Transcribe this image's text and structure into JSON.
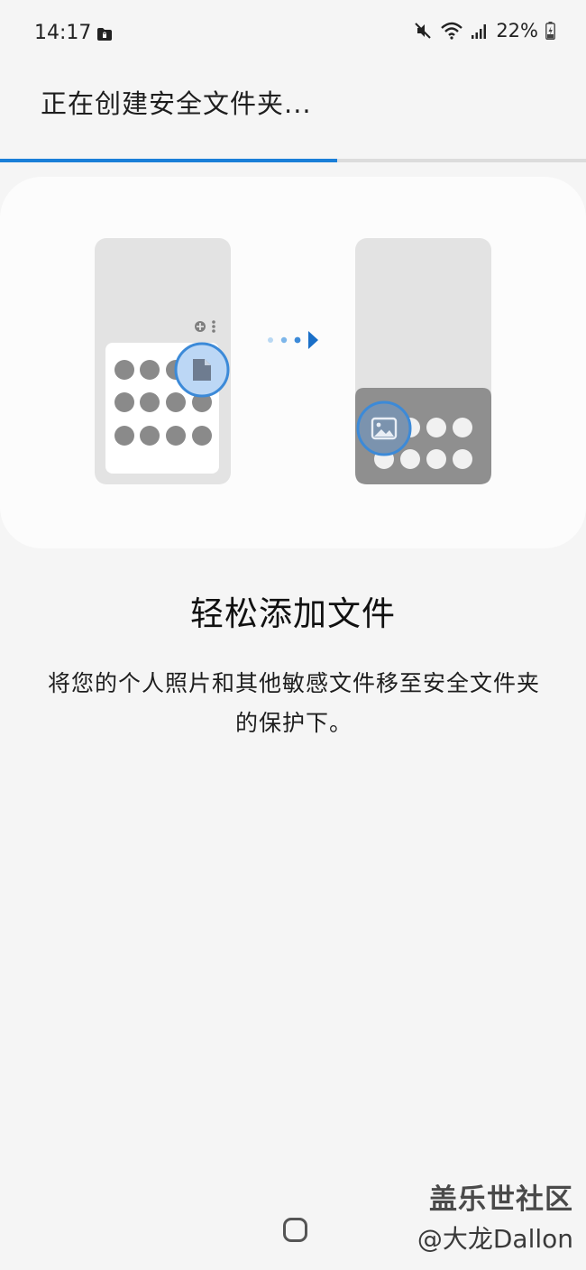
{
  "status_bar": {
    "time": "14:17",
    "battery": "22%",
    "icons": [
      "folder-lock-icon",
      "mute-icon",
      "wifi-icon",
      "signal-icon",
      "battery-charging-icon"
    ]
  },
  "header": {
    "title": "正在创建安全文件夹..."
  },
  "progress": {
    "fraction": 0.575,
    "fill_color": "#1a7fd8",
    "track_color": "#dcdcdc"
  },
  "illustration": {
    "accent_color": "#1a7fd8",
    "highlight_color": "#bcd7f5"
  },
  "feature": {
    "title": "轻松添加文件",
    "description": "将您的个人照片和其他敏感文件移至安全文件夹的保护下。"
  },
  "navigation": {
    "home_icon": "home-button-icon"
  },
  "watermark": {
    "site": "盖乐世社区",
    "author": "@大龙Dallon"
  }
}
